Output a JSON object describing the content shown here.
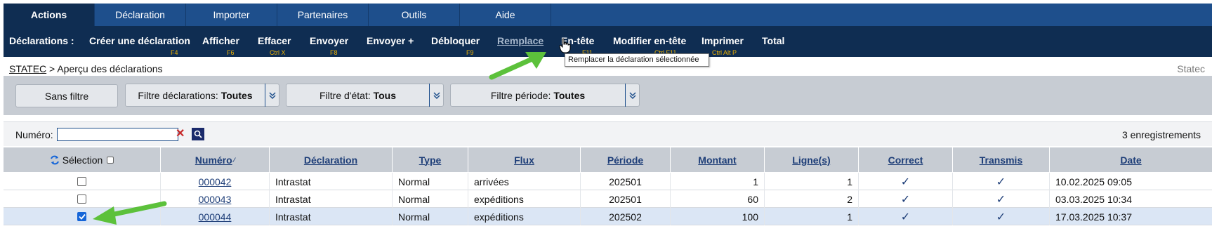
{
  "tabs": [
    "Actions",
    "Déclaration",
    "Importer",
    "Partenaires",
    "Outils",
    "Aide"
  ],
  "menu": {
    "title": "Déclarations :",
    "items": [
      {
        "label": "Créer une déclaration",
        "shortcut": "F4"
      },
      {
        "label": "Afficher",
        "shortcut": "F6"
      },
      {
        "label": "Effacer",
        "shortcut": "Ctrl X"
      },
      {
        "label": "Envoyer",
        "shortcut": "F8"
      },
      {
        "label": "Envoyer +",
        "shortcut": ""
      },
      {
        "label": "Débloquer",
        "shortcut": "F9"
      },
      {
        "label": "Remplace",
        "shortcut": ""
      },
      {
        "label": "En-tête",
        "shortcut": "F11"
      },
      {
        "label": "Modifier en-tête",
        "shortcut": "Ctrl F11"
      },
      {
        "label": "Imprimer",
        "shortcut": "Ctrl Alt P"
      },
      {
        "label": "Total",
        "shortcut": ""
      }
    ],
    "tooltip": "Remplacer la déclaration sélectionnée"
  },
  "breadcrumb": {
    "root": "STATEC",
    "current": "> Aperçu des déclarations"
  },
  "brand": "Statec",
  "filters": {
    "no_filter": "Sans filtre",
    "decl_label": "Filtre déclarations:",
    "decl_value": "Toutes",
    "state_label": "Filtre d'état:",
    "state_value": "Tous",
    "period_label": "Filtre période:",
    "period_value": "Toutes"
  },
  "search": {
    "label": "Numéro:",
    "value": "",
    "placeholder": ""
  },
  "records": "3 enregistrements",
  "table": {
    "headers": {
      "selection": "Sélection",
      "numero": "Numéro",
      "declaration": "Déclaration",
      "type": "Type",
      "flux": "Flux",
      "periode": "Période",
      "montant": "Montant",
      "lignes": "Ligne(s)",
      "correct": "Correct",
      "transmis": "Transmis",
      "date": "Date"
    },
    "rows": [
      {
        "numero": "000042",
        "declaration": "Intrastat",
        "type": "Normal",
        "flux": "arrivées",
        "periode": "202501",
        "montant": "1",
        "lignes": "1",
        "correct": "✓",
        "transmis": "✓",
        "date": "10.02.2025 09:05",
        "selected": false
      },
      {
        "numero": "000043",
        "declaration": "Intrastat",
        "type": "Normal",
        "flux": "expéditions",
        "periode": "202501",
        "montant": "60",
        "lignes": "2",
        "correct": "✓",
        "transmis": "✓",
        "date": "03.03.2025 10:34",
        "selected": false
      },
      {
        "numero": "000044",
        "declaration": "Intrastat",
        "type": "Normal",
        "flux": "expéditions",
        "periode": "202502",
        "montant": "100",
        "lignes": "1",
        "correct": "✓",
        "transmis": "✓",
        "date": "17.03.2025 10:37",
        "selected": true
      }
    ]
  },
  "colors": {
    "tabbar": "#1e4f8c",
    "menubar": "#0f2d52",
    "shortcut": "#f0b400",
    "arrow": "#5cc13b",
    "checked": "#1565d8"
  }
}
